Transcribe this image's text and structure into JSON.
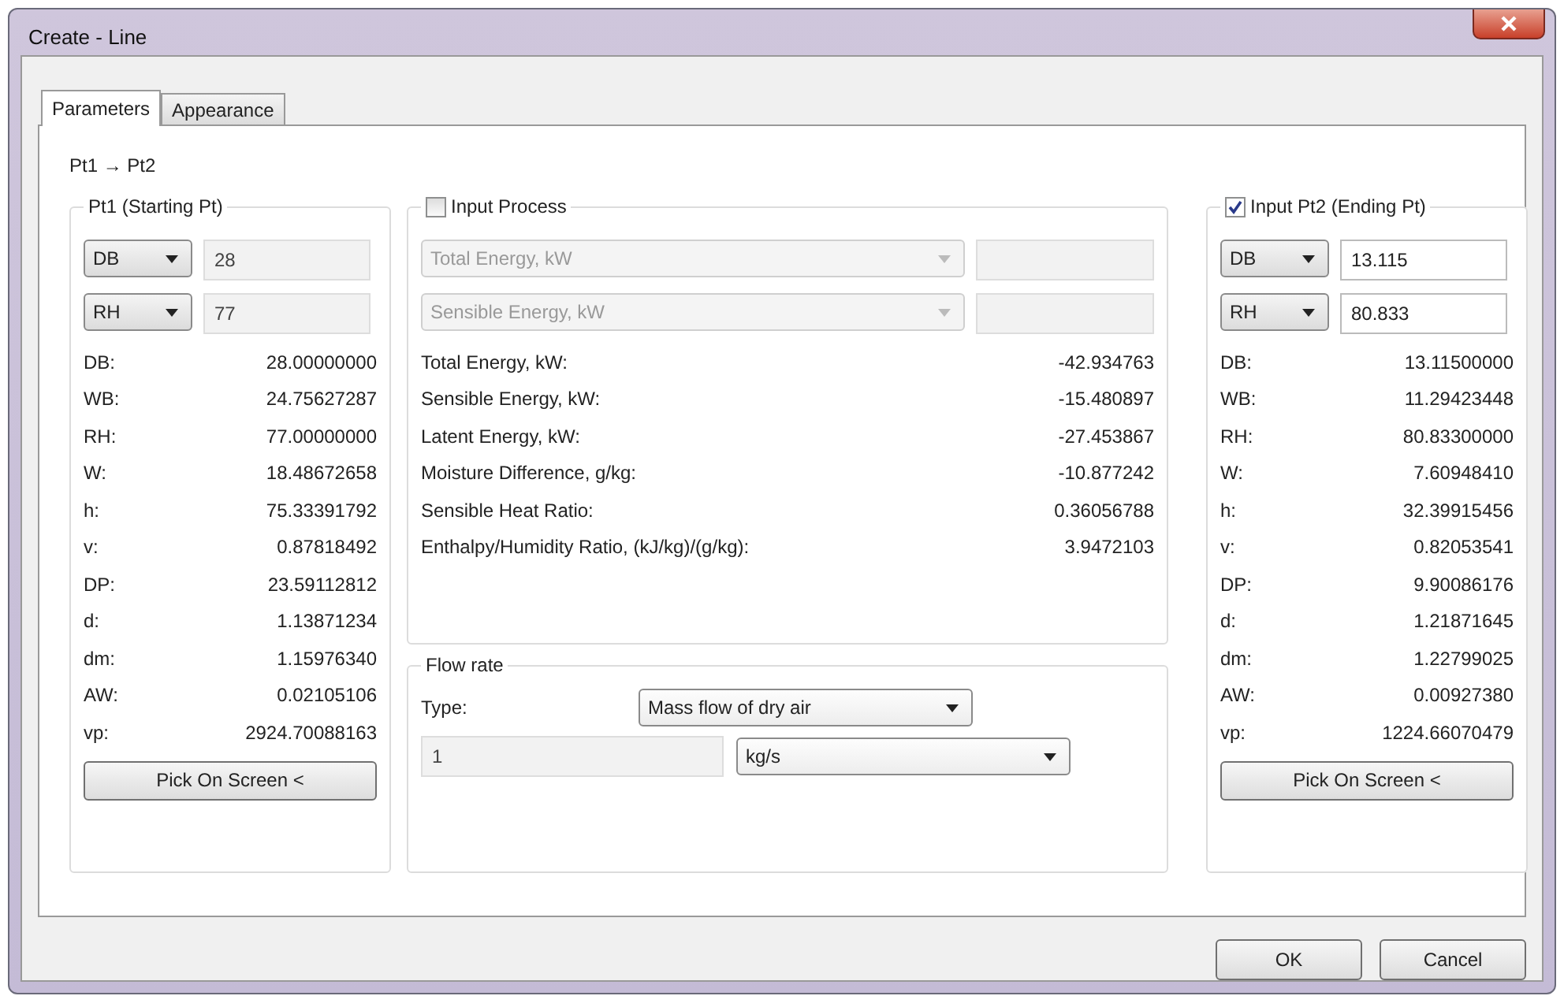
{
  "window": {
    "title": "Create - Line"
  },
  "tabs": [
    {
      "label": "Parameters",
      "selected": true
    },
    {
      "label": "Appearance",
      "selected": false
    }
  ],
  "path_label": "Pt1 → Pt2",
  "start_point": {
    "title": "Pt1 (Starting Pt)",
    "inputs": [
      {
        "property": "DB",
        "value": "28",
        "disabled": true
      },
      {
        "property": "RH",
        "value": "77",
        "disabled": true
      }
    ],
    "properties": [
      {
        "label": "DB:",
        "value": "28.00000000"
      },
      {
        "label": "WB:",
        "value": "24.75627287"
      },
      {
        "label": "RH:",
        "value": "77.00000000"
      },
      {
        "label": "W:",
        "value": "18.48672658"
      },
      {
        "label": "h:",
        "value": "75.33391792"
      },
      {
        "label": "v:",
        "value": "0.87818492"
      },
      {
        "label": "DP:",
        "value": "23.59112812"
      },
      {
        "label": "d:",
        "value": "1.13871234"
      },
      {
        "label": "dm:",
        "value": "1.15976340"
      },
      {
        "label": "AW:",
        "value": "0.02105106"
      },
      {
        "label": "vp:",
        "value": "2924.70088163"
      }
    ],
    "button": "Pick On Screen <"
  },
  "process": {
    "title": "Input Process",
    "checked": false,
    "inputs": [
      {
        "property": "Total Energy, kW",
        "disabled": true
      },
      {
        "property": "Sensible Energy, kW",
        "disabled": true
      }
    ],
    "results": [
      {
        "label": "Total Energy, kW:",
        "value": "-42.934763"
      },
      {
        "label": "Sensible Energy, kW:",
        "value": "-15.480897"
      },
      {
        "label": "Latent Energy, kW:",
        "value": "-27.453867"
      },
      {
        "label": "Moisture Difference, g/kg:",
        "value": "-10.877242"
      },
      {
        "label": "Sensible Heat Ratio:",
        "value": "0.36056788"
      },
      {
        "label": "Enthalpy/Humidity Ratio, (kJ/kg)/(g/kg):",
        "value": "3.9472103"
      }
    ]
  },
  "flow_rate": {
    "title": "Flow rate",
    "type_label": "Type:",
    "type_value": "Mass flow of dry air",
    "amount": "1",
    "unit": "kg/s"
  },
  "end_point": {
    "title": "Input Pt2 (Ending Pt)",
    "checked": true,
    "inputs": [
      {
        "property": "DB",
        "value": "13.115",
        "disabled": false
      },
      {
        "property": "RH",
        "value": "80.833",
        "disabled": false
      }
    ],
    "properties": [
      {
        "label": "DB:",
        "value": "13.11500000"
      },
      {
        "label": "WB:",
        "value": "11.29423448"
      },
      {
        "label": "RH:",
        "value": "80.83300000"
      },
      {
        "label": "W:",
        "value": "7.60948410"
      },
      {
        "label": "h:",
        "value": "32.39915456"
      },
      {
        "label": "v:",
        "value": "0.82053541"
      },
      {
        "label": "DP:",
        "value": "9.90086176"
      },
      {
        "label": "d:",
        "value": "1.21871645"
      },
      {
        "label": "dm:",
        "value": "1.22799025"
      },
      {
        "label": "AW:",
        "value": "0.00927380"
      },
      {
        "label": "vp:",
        "value": "1224.66070479"
      }
    ],
    "button": "Pick On Screen <"
  },
  "buttons": [
    "OK",
    "Cancel"
  ]
}
